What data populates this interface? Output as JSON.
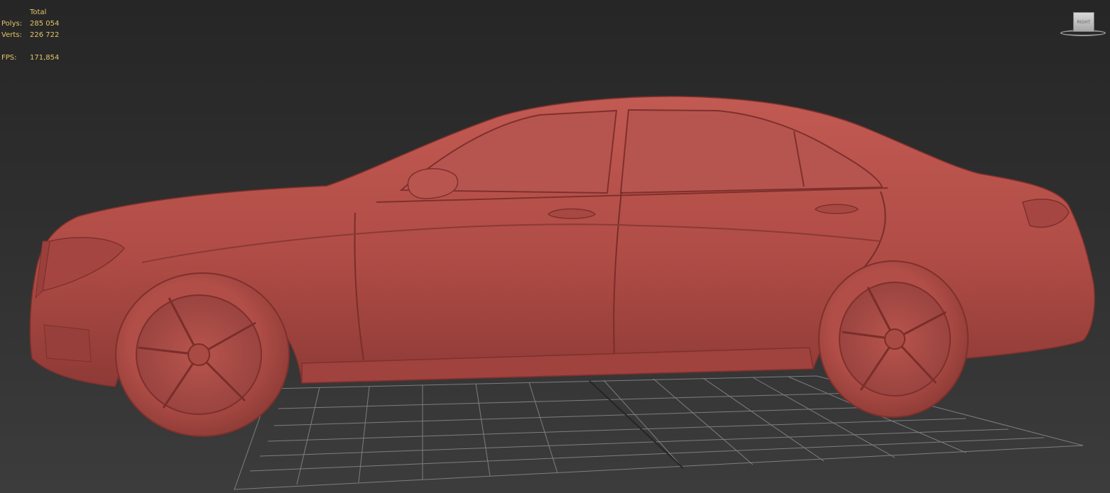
{
  "viewport": {
    "background": "#2e2e2e",
    "stats": {
      "header": "Total",
      "polys_label": "Polys:",
      "polys_value": "285 054",
      "verts_label": "Verts:",
      "verts_value": "226 722",
      "fps_label": "FPS:",
      "fps_value": "171,854",
      "text_color": "#e3c56a"
    },
    "viewcube": {
      "face_label": "RIGHT"
    },
    "model": {
      "icon": "car-model",
      "color": "#b8504a"
    },
    "grid": {
      "color": "#8a8a8a"
    }
  }
}
